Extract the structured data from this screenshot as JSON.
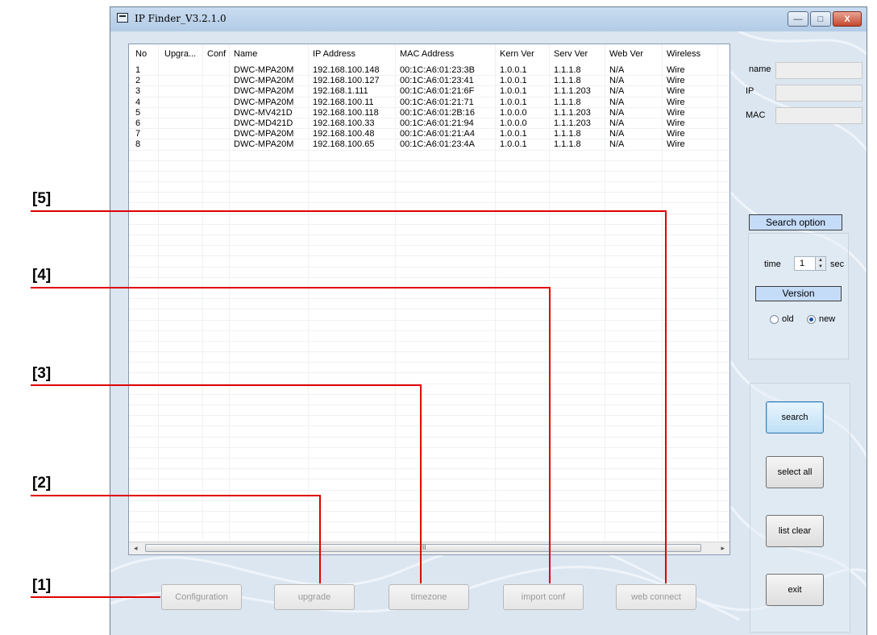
{
  "window": {
    "title": "IP Finder_V3.2.1.0",
    "controls": [
      "—",
      "□",
      "X"
    ]
  },
  "table": {
    "columns": [
      "No",
      "Upgra...",
      "Conf",
      "Name",
      "IP Address",
      "MAC Address",
      "Kern Ver",
      "Serv Ver",
      "Web Ver",
      "Wireless"
    ],
    "rows": [
      [
        "1",
        "",
        "",
        "DWC-MPA20M",
        "192.168.100.148",
        "00:1C:A6:01:23:3B",
        "1.0.0.1",
        "1.1.1.8",
        "N/A",
        "Wire"
      ],
      [
        "2",
        "",
        "",
        "DWC-MPA20M",
        "192.168.100.127",
        "00:1C:A6:01:23:41",
        "1.0.0.1",
        "1.1.1.8",
        "N/A",
        "Wire"
      ],
      [
        "3",
        "",
        "",
        "DWC-MPA20M",
        "192.168.1.111",
        "00:1C:A6:01:21:6F",
        "1.0.0.1",
        "1.1.1.203",
        "N/A",
        "Wire"
      ],
      [
        "4",
        "",
        "",
        "DWC-MPA20M",
        "192.168.100.11",
        "00:1C:A6:01:21:71",
        "1.0.0.1",
        "1.1.1.8",
        "N/A",
        "Wire"
      ],
      [
        "5",
        "",
        "",
        "DWC-MV421D",
        "192.168.100.118",
        "00:1C:A6:01:2B:16",
        "1.0.0.0",
        "1.1.1.203",
        "N/A",
        "Wire"
      ],
      [
        "6",
        "",
        "",
        "DWC-MD421D",
        "192.168.100.33",
        "00:1C:A6:01:21:94",
        "1.0.0.0",
        "1.1.1.203",
        "N/A",
        "Wire"
      ],
      [
        "7",
        "",
        "",
        "DWC-MPA20M",
        "192.168.100.48",
        "00:1C:A6:01:21:A4",
        "1.0.0.1",
        "1.1.1.8",
        "N/A",
        "Wire"
      ],
      [
        "8",
        "",
        "",
        "DWC-MPA20M",
        "192.168.100.65",
        "00:1C:A6:01:23:4A",
        "1.0.0.1",
        "1.1.1.8",
        "N/A",
        "Wire"
      ]
    ],
    "scroll_left": "◂",
    "scroll_right": "▸",
    "scroll_grip": "III"
  },
  "side": {
    "name_label": "name",
    "ip_label": "IP",
    "mac_label": "MAC",
    "search_option": "Search option",
    "time_label": "time",
    "time_value": "1",
    "sec_label": "sec",
    "version_label": "Version",
    "old_label": "old",
    "new_label": "new"
  },
  "buttons": {
    "search": "search",
    "select_all": "select all",
    "list_clear": "list clear",
    "exit": "exit",
    "configuration": "Configuration",
    "upgrade": "upgrade",
    "timezone": "timezone",
    "import_conf": "import conf",
    "web_connect": "web connect"
  },
  "callouts": [
    "[1]",
    "[2]",
    "[3]",
    "[4]",
    "[5]"
  ],
  "colors": {
    "callout_line": "#e00000",
    "window_bg": "#dbe6f1",
    "accent": "#c5dcf9"
  }
}
